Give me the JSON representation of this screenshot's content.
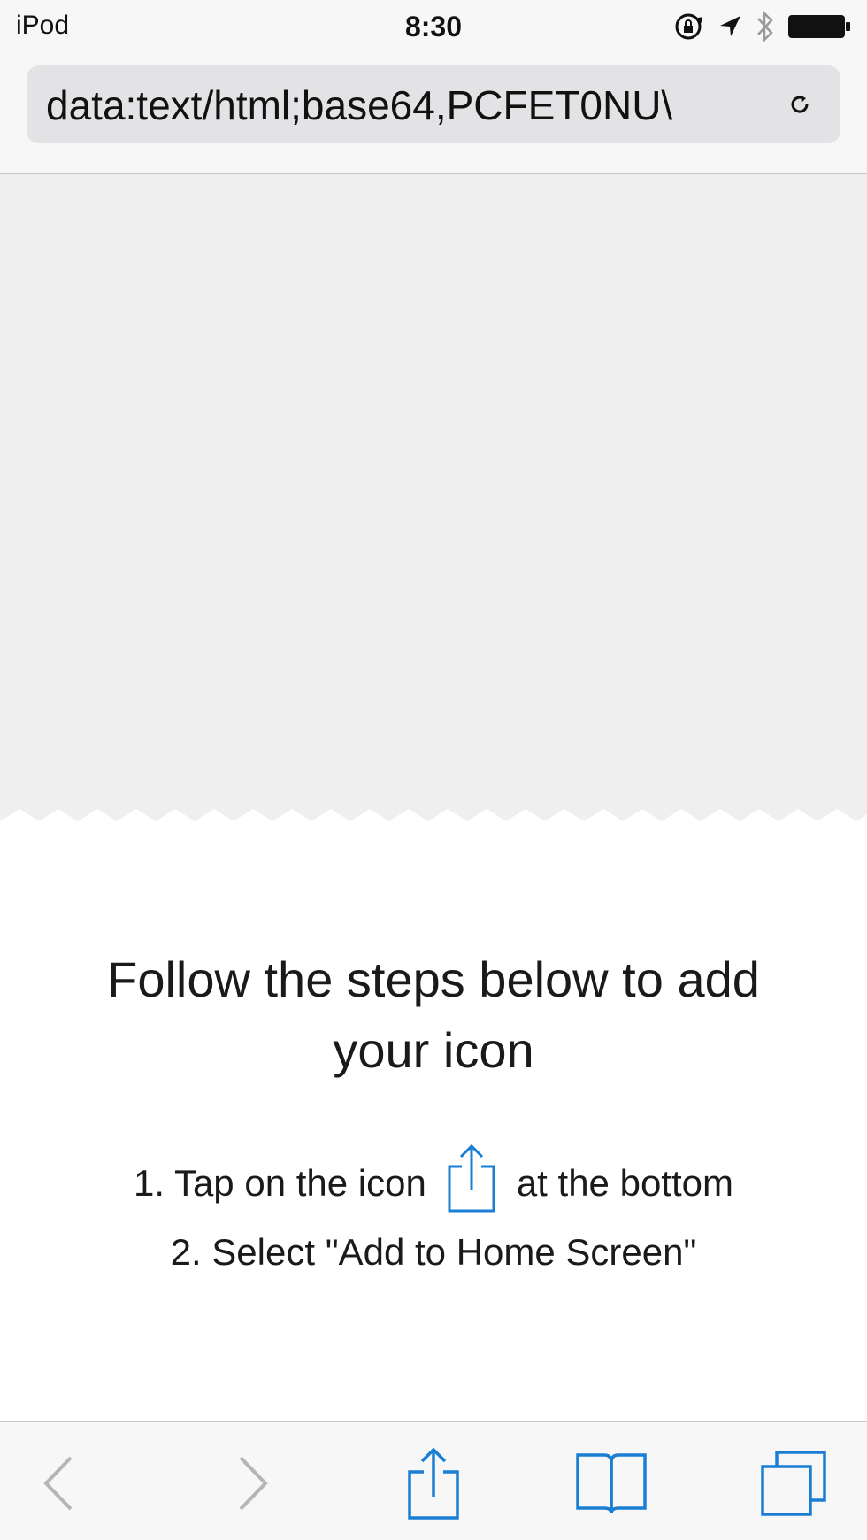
{
  "status_bar": {
    "device": "iPod",
    "time": "8:30",
    "icons": [
      "orientation-lock-icon",
      "location-arrow-icon",
      "bluetooth-icon",
      "battery-icon"
    ]
  },
  "address_bar": {
    "url": "data:text/html;base64,PCFET0NU\\"
  },
  "content": {
    "headline": "Follow the steps below to add your icon",
    "step1_before": "1. Tap on the icon",
    "step1_after": "at the bottom",
    "step2": "2. Select \"Add to Home Screen\""
  },
  "toolbar": {
    "items": [
      "back-icon",
      "forward-icon",
      "share-icon",
      "bookmarks-icon",
      "tabs-icon"
    ]
  },
  "colors": {
    "accent": "#1a7fd4",
    "disabled": "#b5b5b5",
    "bar_bg": "#f7f7f7",
    "preview_bg": "#efefef"
  }
}
